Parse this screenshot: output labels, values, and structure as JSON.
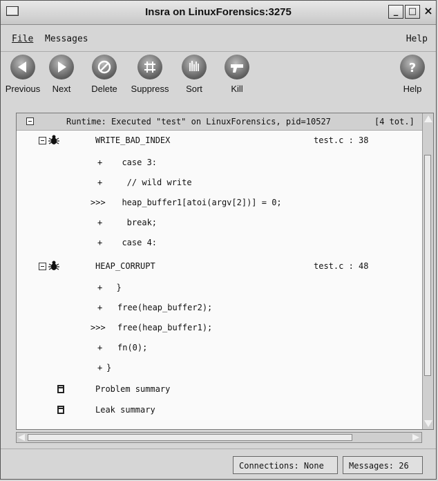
{
  "window": {
    "title": "Insra on LinuxForensics:3275"
  },
  "menubar": {
    "file_label": "File",
    "messages_label": "Messages",
    "help_label": "Help"
  },
  "toolbar": {
    "previous_label": "Previous",
    "next_label": "Next",
    "delete_label": "Delete",
    "suppress_label": "Suppress",
    "sort_label": "Sort",
    "kill_label": "Kill",
    "help_label": "Help"
  },
  "list": {
    "header": "Runtime: Executed \"test\" on LinuxForensics, pid=10527",
    "header_count": "[4 tot.]",
    "errors": [
      {
        "name": "WRITE_BAD_INDEX",
        "location": "test.c : 38",
        "lines": [
          {
            "marker": "+",
            "code": "  case 3:"
          },
          {
            "marker": "+",
            "code": "   // wild write"
          },
          {
            "marker": ">>>",
            "code": "  heap_buffer1[atoi(argv[2])] = 0;"
          },
          {
            "marker": "+",
            "code": "   break;"
          },
          {
            "marker": "+",
            "code": "  case 4:"
          }
        ]
      },
      {
        "name": "HEAP_CORRUPT",
        "location": "test.c : 48",
        "lines": [
          {
            "marker": "+",
            "code": "  }"
          },
          {
            "marker": "+",
            "code": "free(heap_buffer2);"
          },
          {
            "marker": ">>>",
            "code": "free(heap_buffer1);"
          },
          {
            "marker": "+",
            "code": "fn(0);"
          },
          {
            "marker": "+",
            "code": "}"
          }
        ]
      }
    ],
    "summaries": [
      {
        "label": "Problem summary"
      },
      {
        "label": "Leak summary"
      }
    ]
  },
  "status": {
    "connections": "Connections: None",
    "messages": "Messages: 26"
  }
}
